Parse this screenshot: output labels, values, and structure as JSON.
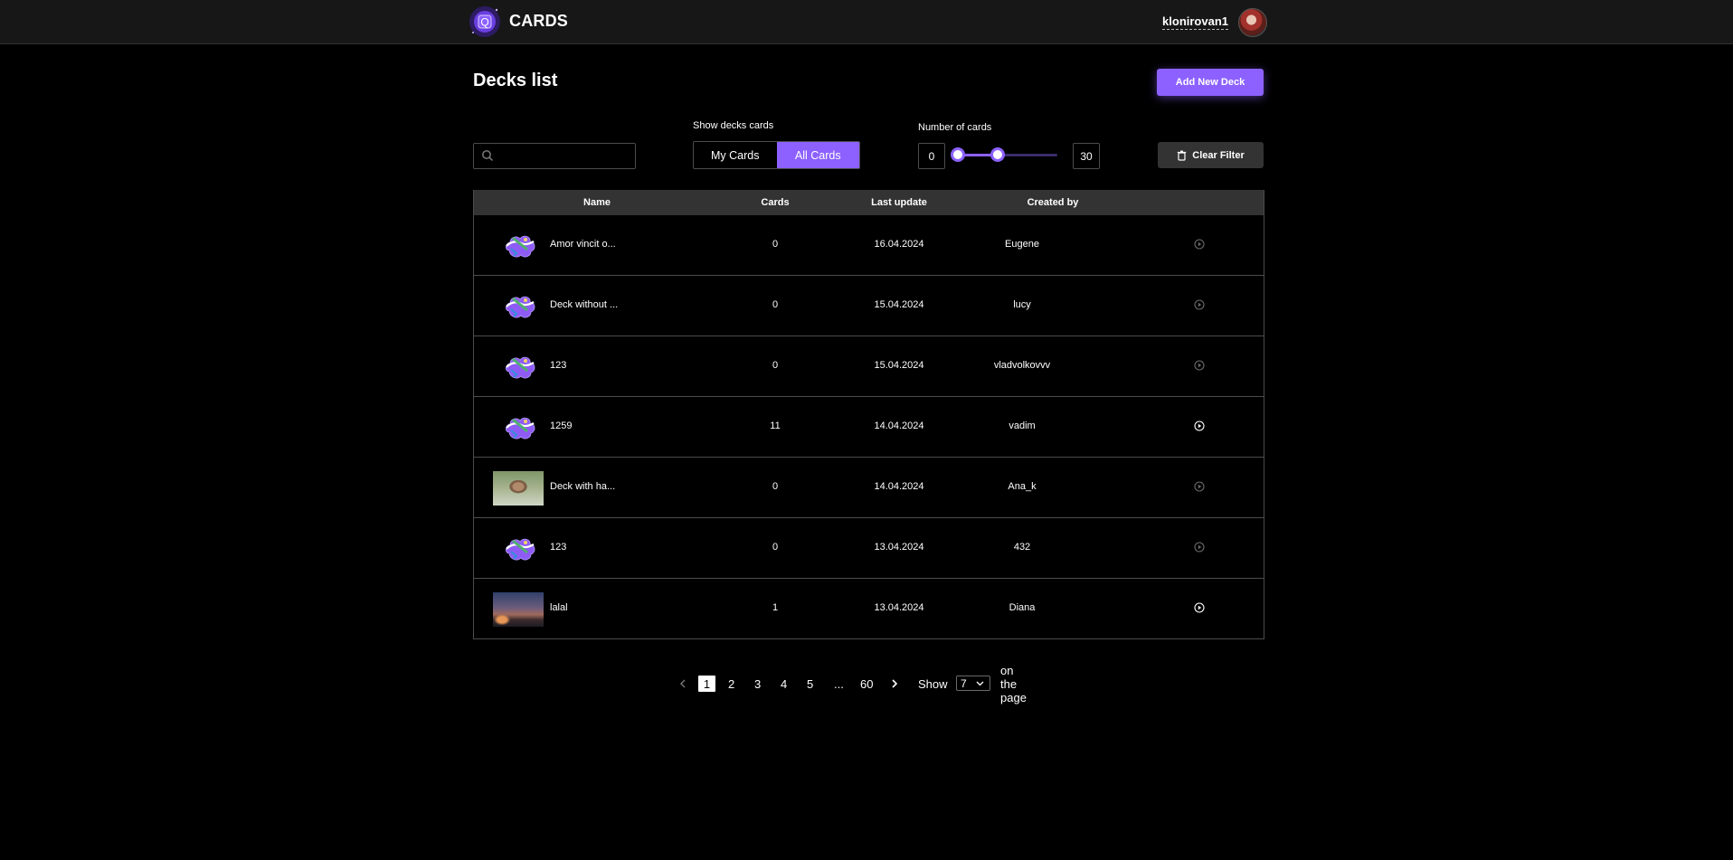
{
  "header": {
    "app_name": "CARDS",
    "logo_letter": "Q",
    "username": "klonirovan1"
  },
  "page": {
    "title": "Decks list",
    "add_button": "Add New Deck"
  },
  "filters": {
    "search_placeholder": "",
    "show_label": "Show decks cards",
    "tabs": [
      {
        "label": "My Cards",
        "active": false
      },
      {
        "label": "All Cards",
        "active": true
      }
    ],
    "number_label": "Number of cards",
    "min": "0",
    "max": "30",
    "slider_range_fraction": [
      0.0,
      0.4
    ],
    "clear_button": "Clear Filter"
  },
  "table": {
    "columns": [
      "Name",
      "Cards",
      "Last update",
      "Created by"
    ],
    "rows": [
      {
        "cover": "cloud-cover",
        "name": "Amor vincit o...",
        "cards": "0",
        "updated": "16.04.2024",
        "author": "Eugene",
        "play_enabled": false
      },
      {
        "cover": "cloud-cover",
        "name": "Deck without ...",
        "cards": "0",
        "updated": "15.04.2024",
        "author": "lucy",
        "play_enabled": false
      },
      {
        "cover": "cloud-cover",
        "name": "123",
        "cards": "0",
        "updated": "15.04.2024",
        "author": "vladvolkovvv",
        "play_enabled": false
      },
      {
        "cover": "cloud-cover",
        "name": "1259",
        "cards": "11",
        "updated": "14.04.2024",
        "author": "vadim",
        "play_enabled": true
      },
      {
        "cover": "hamster-photo",
        "name": "Deck with ha...",
        "cards": "0",
        "updated": "14.04.2024",
        "author": "Ana_k",
        "play_enabled": false
      },
      {
        "cover": "cloud-cover",
        "name": "123",
        "cards": "0",
        "updated": "13.04.2024",
        "author": "432",
        "play_enabled": false
      },
      {
        "cover": "sunset-photo",
        "name": "lalal",
        "cards": "1",
        "updated": "13.04.2024",
        "author": "Diana",
        "play_enabled": true
      }
    ]
  },
  "pagination": {
    "pages": [
      "1",
      "2",
      "3",
      "4",
      "5",
      "...",
      "60"
    ],
    "current": "1",
    "show_label": "Show",
    "per_page": "7",
    "suffix": "on the page"
  },
  "colors": {
    "accent": "#8c61ff",
    "header_bg": "#171717",
    "table_head_bg": "#333333",
    "border": "#4c4c4c"
  }
}
